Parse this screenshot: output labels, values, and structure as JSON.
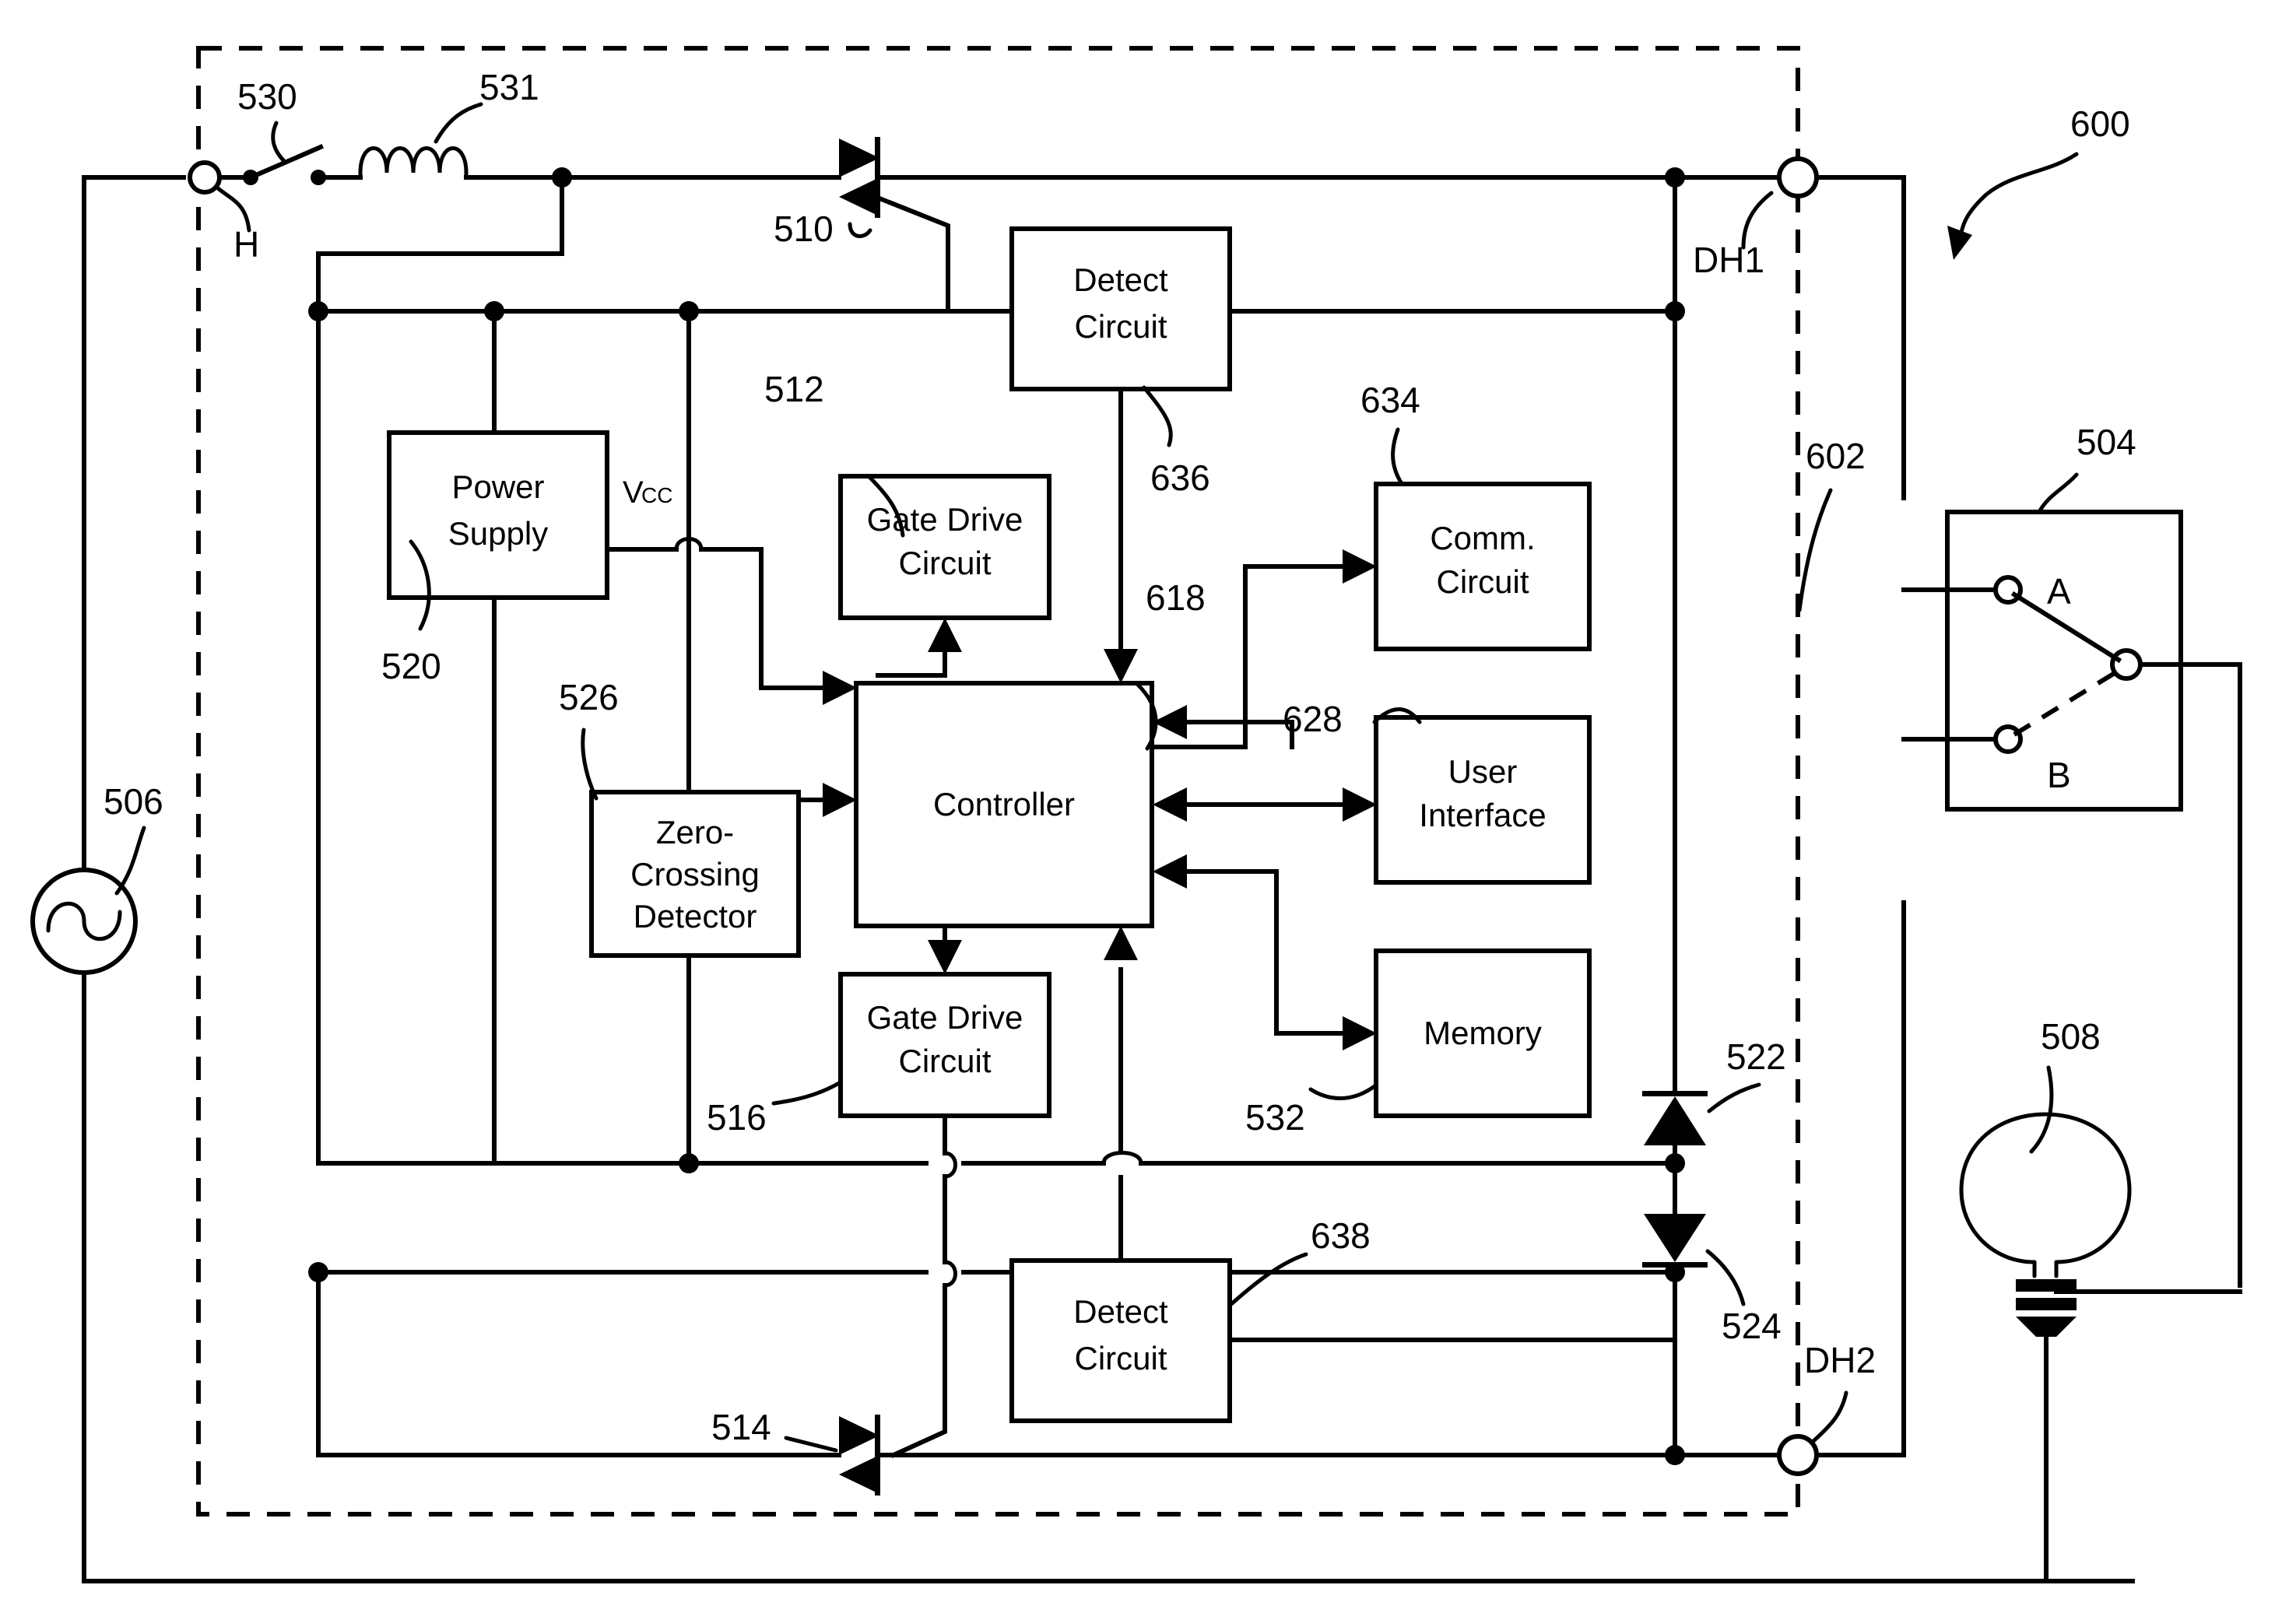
{
  "figure": {
    "type": "patent-schematic",
    "overall_ref": "600",
    "dimmer_boundary_ref": "602"
  },
  "terminals": {
    "hot_label": "H",
    "hot_ref": "530",
    "dh1_label": "DH1",
    "dh2_label": "DH2"
  },
  "blocks": [
    {
      "id": "power_supply",
      "line1": "Power",
      "line2": "Supply",
      "ref": "520"
    },
    {
      "id": "gate_drive_top",
      "line1": "Gate Drive",
      "line2": "Circuit",
      "ref": "512"
    },
    {
      "id": "detect_top",
      "line1": "Detect",
      "line2": "Circuit",
      "ref": "636"
    },
    {
      "id": "zero_crossing",
      "line1": "Zero-",
      "line2": "Crossing",
      "line3": "Detector",
      "ref": "526"
    },
    {
      "id": "controller",
      "line1": "Controller",
      "ref": "618"
    },
    {
      "id": "comm_circuit",
      "line1": "Comm.",
      "line2": "Circuit",
      "ref": "634"
    },
    {
      "id": "user_interface",
      "line1": "User",
      "line2": "Interface",
      "ref": "628"
    },
    {
      "id": "memory",
      "line1": "Memory",
      "ref": "532"
    },
    {
      "id": "gate_drive_bottom",
      "line1": "Gate Drive",
      "line2": "Circuit",
      "ref": "516"
    },
    {
      "id": "detect_bottom",
      "line1": "Detect",
      "line2": "Circuit",
      "ref": "638"
    }
  ],
  "components": {
    "inductor_ref": "531",
    "triac_top_ref": "510",
    "triac_bottom_ref": "514",
    "diode_upper_ref": "522",
    "diode_lower_ref": "524",
    "ac_source_ref": "506",
    "switch_box_ref": "504",
    "lamp_ref": "508",
    "vcc_label": "V",
    "vcc_subscript": "CC"
  },
  "switch_positions": {
    "a": "A",
    "b": "B"
  },
  "colors": {
    "ink": "#000000",
    "paper": "#ffffff"
  }
}
